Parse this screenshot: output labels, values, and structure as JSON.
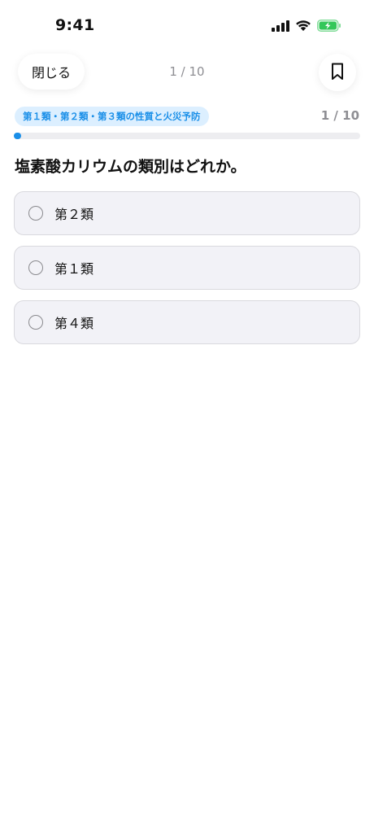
{
  "status_bar": {
    "time": "9:41",
    "icons": [
      "signal-icon",
      "wifi-icon",
      "battery-charging-icon"
    ],
    "battery_color": "#34c759"
  },
  "header": {
    "close_label": "閉じる",
    "counter": "1 / 10",
    "bookmark_icon": "bookmark-icon"
  },
  "category": {
    "label": "第１類・第２類・第３類の性質と火災予防"
  },
  "progress": {
    "counter": "1 / 10",
    "current": 1,
    "total": 10,
    "fraction": 0.02,
    "accent_color": "#1a8fe8"
  },
  "question": {
    "text": "塩素酸カリウムの類別はどれか。"
  },
  "options": [
    {
      "label": "第２類",
      "selected": false
    },
    {
      "label": "第１類",
      "selected": false
    },
    {
      "label": "第４類",
      "selected": false
    }
  ]
}
